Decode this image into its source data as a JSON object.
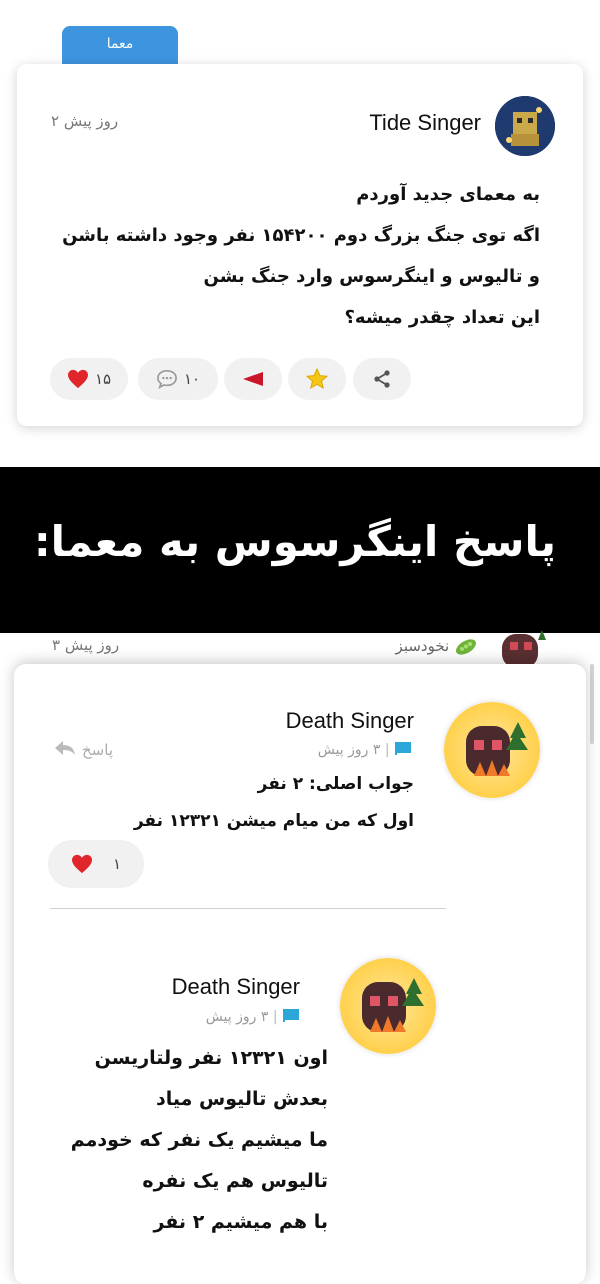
{
  "category_tag": "معما",
  "post": {
    "author": "Tide Singer",
    "time": "۲ روز پیش",
    "body_lines": [
      "به معمای جدید آوردم",
      "اگه توی جنگ بزرگ دوم ۱۵۴۲۰۰ نفر وجود داشته باشن",
      "و تالیوس و اینگرسوس وارد جنگ بشن",
      "این تعداد چقدر میشه؟"
    ],
    "like_count": "۱۵",
    "comment_count": "۱۰",
    "icons": [
      "heart-icon",
      "comment-icon",
      "flag-icon",
      "star-icon",
      "share-icon"
    ]
  },
  "banner": {
    "text": "پاسخ اینگرسوس به معما:"
  },
  "background_comment": {
    "time": "۳ روز پیش",
    "name": "نخودسبز"
  },
  "comments": [
    {
      "author": "Death Singer",
      "time": "۳ روز پیش",
      "reply_label": "پاسخ",
      "lines": [
        "جواب اصلی: ۲ نفر",
        "اول که من میام میشن ۱۲۳۲۱ نفر"
      ],
      "like_count": "۱"
    },
    {
      "author": "Death Singer",
      "time": "۳ روز پیش",
      "lines": [
        "اون ۱۲۳۲۱ نفر ولتاریسن",
        "بعدش تالیوس میاد",
        "ما میشیم یک نفر که خودمم",
        "تالیوس هم یک نفره",
        "با هم میشیم ۲ نفر"
      ]
    }
  ],
  "colors": {
    "tag": "#3d95e0",
    "banner": "#000000",
    "heart": "#e0252b",
    "flag": "#2aa6d8"
  }
}
